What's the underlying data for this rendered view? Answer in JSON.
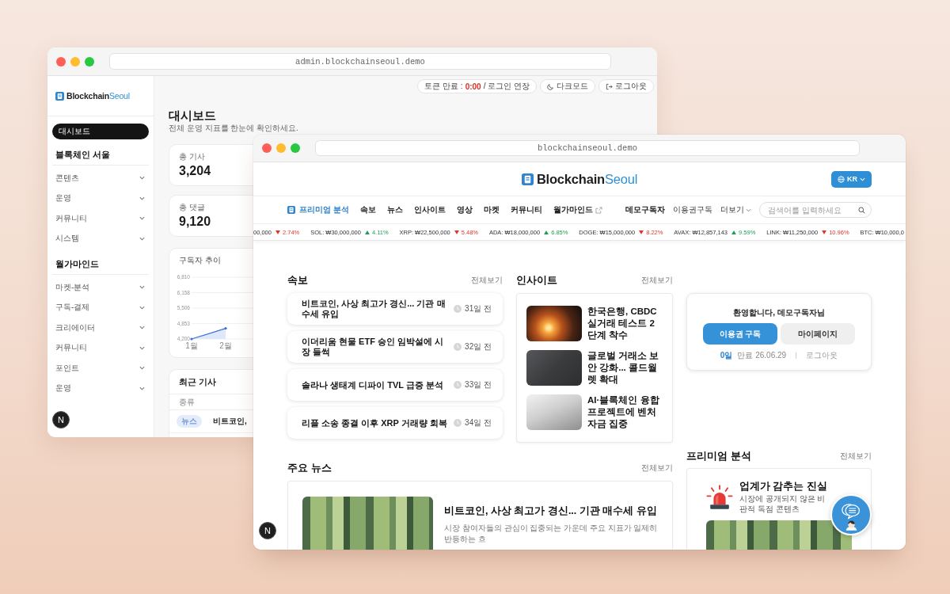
{
  "back_window": {
    "address": "admin.blockchainseoul.demo",
    "logo": {
      "text": "Blockchain",
      "accent": "Seoul"
    },
    "sidebar": {
      "menu": [
        {
          "label": "대시보드",
          "selected": true
        }
      ],
      "sections": [
        {
          "title": "블록체인 서울",
          "items": [
            {
              "label": "콘텐츠",
              "expanded": false
            },
            {
              "label": "운영",
              "expanded": false
            },
            {
              "label": "커뮤니티",
              "expanded": false
            },
            {
              "label": "시스템",
              "expanded": false
            }
          ]
        },
        {
          "title": "월가마인드",
          "items": [
            {
              "label": "마켓-분석",
              "expanded": false
            },
            {
              "label": "구독-결제",
              "expanded": false
            },
            {
              "label": "크리에이터",
              "expanded": false
            },
            {
              "label": "커뮤니티",
              "expanded": false
            },
            {
              "label": "포인트",
              "expanded": false
            },
            {
              "label": "운영",
              "expanded": false
            }
          ]
        }
      ]
    },
    "top_bar": {
      "session": {
        "label": "토큰 만료 :",
        "countdown": "0:00",
        "extend": "/ 로그인 연장"
      },
      "buttons": [
        {
          "kind": "dark-mode",
          "label": "다크모드"
        },
        {
          "kind": "logout",
          "label": "로그아웃"
        }
      ]
    },
    "page": {
      "title": "대시보드",
      "subtitle": "전체 운영 지표를 한눈에 확인하세요."
    },
    "stats": [
      {
        "label": "총 기사",
        "value": "3,204"
      },
      {
        "label": "총 댓글",
        "value": "9,120"
      }
    ],
    "subscriber_chart": {
      "title": "구독자 추이",
      "chart_data": {
        "type": "area",
        "categories": [
          "1월",
          "2월"
        ],
        "values": [
          4200,
          4650
        ],
        "ylim": [
          4200,
          6810
        ],
        "yticks": [
          {
            "value": 4200,
            "label": "4,200"
          },
          {
            "value": 4853,
            "label": "4,853"
          },
          {
            "value": 5506,
            "label": "5,506"
          },
          {
            "value": 6158,
            "label": "6,158"
          },
          {
            "value": 6810,
            "label": "6,810"
          }
        ],
        "grid": true
      }
    },
    "recent_articles": {
      "title": "최근 기사",
      "columns": [
        "종류"
      ],
      "rows": [
        {
          "category": "뉴스",
          "column_2": "비트코인,"
        }
      ]
    },
    "dev_badge": "N"
  },
  "front_window": {
    "address": "blockchainseoul.demo",
    "logo": {
      "text": "Blockchain",
      "accent": "Seoul"
    },
    "language_button": "KR",
    "nav": [
      {
        "label": "프리미엄 분석",
        "kind": "premium"
      },
      {
        "label": "속보",
        "kind": "plain"
      },
      {
        "label": "뉴스",
        "kind": "plain"
      },
      {
        "label": "인사이트",
        "kind": "plain"
      },
      {
        "label": "영상",
        "kind": "plain"
      },
      {
        "label": "마켓",
        "kind": "plain"
      },
      {
        "label": "커뮤니티",
        "kind": "plain"
      },
      {
        "label": "월가마인드",
        "kind": "external"
      }
    ],
    "user_links": [
      {
        "label": "데모구독자",
        "kind": "user"
      },
      {
        "label": "이용권구독",
        "kind": "link"
      },
      {
        "label": "더보기",
        "kind": "menu"
      }
    ],
    "search": {
      "placeholder": "검색어를 입력하세요"
    },
    "ticker": [
      {
        "label": "00,000",
        "change": "2.74%",
        "rising": false
      },
      {
        "label": "SOL: ₩30,000,000",
        "change": "4.11%",
        "rising": true
      },
      {
        "label": "XRP: ₩22,500,000",
        "change": "5.48%",
        "rising": false
      },
      {
        "label": "ADA: ₩18,000,000",
        "change": "6.85%",
        "rising": true
      },
      {
        "label": "DOGE: ₩15,000,000",
        "change": "8.22%",
        "rising": false
      },
      {
        "label": "AVAX: ₩12,857,143",
        "change": "9.59%",
        "rising": true
      },
      {
        "label": "LINK: ₩11,250,000",
        "change": "10.96%",
        "rising": false
      },
      {
        "label": "BTC: ₩10,000,0"
      }
    ],
    "breaking": {
      "title": "속보",
      "more": "전체보기",
      "items": [
        {
          "title": "비트코인, 사상 최고가 경신... 기관 매수세 유입",
          "time": "31일 전"
        },
        {
          "title": "이더리움 현물 ETF 승인 임박설에 시장 들썩",
          "time": "32일 전"
        },
        {
          "title": "솔라나 생태계 디파이 TVL 급증 분석",
          "time": "33일 전"
        },
        {
          "title": "리플 소송 종결 이후 XRP 거래량 회복",
          "time": "34일 전"
        }
      ]
    },
    "insight": {
      "title": "인사이트",
      "more": "전체보기",
      "items": [
        {
          "title": "한국은행, CBDC 실거래 테스트 2단계 착수"
        },
        {
          "title": "글로벌 거래소 보안 강화... 콜드월렛 확대"
        },
        {
          "title": "AI·블록체인 융합 프로젝트에 벤처 자금 집중"
        }
      ]
    },
    "welcome": {
      "greeting": "환영합니다, 데모구독자님",
      "buttons": [
        {
          "label": "이용권 구독",
          "kind": "primary"
        },
        {
          "label": "마이페이지",
          "kind": "secondary"
        }
      ],
      "days_left": "0일",
      "expiry": "만료 26.06.29",
      "logout": "로그아웃"
    },
    "top_news": {
      "title": "주요 뉴스",
      "more": "전체보기",
      "items": [
        {
          "title": "비트코인, 사상 최고가 경신... 기관 매수세 유입",
          "summary": "시장 참여자들의 관심이 집중되는 가운데 주요 지표가 일제히 반등하는 흐"
        }
      ]
    },
    "premium": {
      "title": "프리미엄 분석",
      "more": "전체보기",
      "headline": "업계가 감추는 진실",
      "description": "시장에 공개되지 않은 비판적 독점 콘텐츠"
    },
    "dev_badge": "N"
  }
}
